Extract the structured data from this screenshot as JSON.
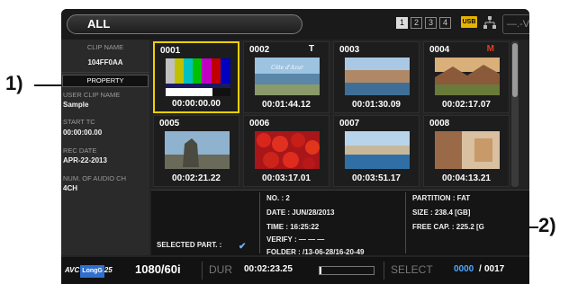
{
  "callouts": {
    "c1": "1)",
    "c2": "2)"
  },
  "topbar": {
    "category": "ALL",
    "slots": [
      "1",
      "2",
      "3",
      "4"
    ],
    "usb": "USB",
    "voltage": "—.-V"
  },
  "left_panel": {
    "clip_name_label": "CLIP NAME",
    "clip_name_value": "104FF0AA",
    "property_button": "PROPERTY",
    "user_clip_name_label": "USER CLIP NAME",
    "user_clip_name_value": "Sample",
    "start_tc_label": "START TC",
    "start_tc_value": "00:00:00.00",
    "rec_date_label": "REC DATE",
    "rec_date_value": "APR-22-2013",
    "num_audio_label": "NUM. OF AUDIO CH",
    "num_audio_value": "4CH"
  },
  "thumbnails": [
    {
      "number": "0001",
      "flag": "",
      "timecode": "00:00:00.00",
      "selected": true,
      "image": "color-bars"
    },
    {
      "number": "0002",
      "flag": "T",
      "timecode": "00:01:44.12",
      "selected": false,
      "image": "coast-text"
    },
    {
      "number": "0003",
      "flag": "",
      "timecode": "00:01:30.09",
      "selected": false,
      "image": "harbor"
    },
    {
      "number": "0004",
      "flag": "M",
      "timecode": "00:02:17.07",
      "selected": false,
      "image": "mountains"
    },
    {
      "number": "0005",
      "flag": "",
      "timecode": "00:02:21.22",
      "selected": false,
      "image": "statue"
    },
    {
      "number": "0006",
      "flag": "",
      "timecode": "00:03:17.01",
      "selected": false,
      "image": "tomatoes"
    },
    {
      "number": "0007",
      "flag": "",
      "timecode": "00:03:51.17",
      "selected": false,
      "image": "bay"
    },
    {
      "number": "0008",
      "flag": "",
      "timecode": "00:04:13.21",
      "selected": false,
      "image": "building"
    }
  ],
  "thumb_caption": "Côte d'Azur",
  "info": {
    "selected_part": "SELECTED PART. :",
    "no": "NO. : 2",
    "date": "DATE : JUN/28/2013",
    "time": "TIME : 16:25:22",
    "verify": "VERIFY : — — —",
    "folder": "FOLDER : /13-06-28/16-20-49",
    "partition": "PARTITION : FAT",
    "size": "SIZE : 238.4 [GB]",
    "free_cap": "FREE CAP. : 225.2 [G"
  },
  "status": {
    "codec": "AVC",
    "codec_sub": "LongG",
    "codec_rate": "25",
    "format": "1080/60i",
    "dur_label": "DUR",
    "dur_value": "00:02:23.25",
    "dur_progress": 0.03,
    "select_label": "SELECT",
    "select_current": "0000",
    "select_slash": "/",
    "select_total": "0017"
  },
  "colors": {
    "selection": "#f0d000",
    "accent_blue": "#4aa8ff",
    "flag_red": "#e83a1a"
  }
}
